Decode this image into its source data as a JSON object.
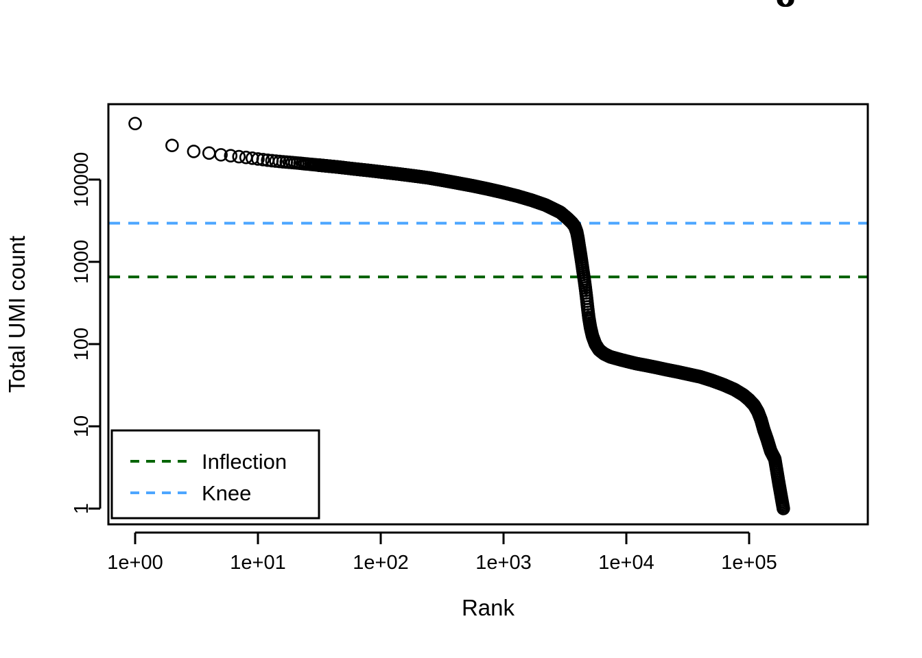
{
  "chart_data": {
    "type": "line",
    "title": "",
    "subtitle": "",
    "xlabel": "Rank",
    "ylabel": "Total UMI count",
    "xscale": "log",
    "yscale": "log",
    "grid": false,
    "xlim": [
      1,
      220000
    ],
    "ylim": [
      1,
      60000
    ],
    "xticks": [
      1,
      10,
      100,
      1000,
      10000,
      100000
    ],
    "xticklabels": [
      "1e+00",
      "1e+01",
      "1e+02",
      "1e+03",
      "1e+04",
      "1e+05"
    ],
    "yticks": [
      1,
      10,
      100,
      1000,
      10000
    ],
    "yticklabels": [
      "1",
      "10",
      "100",
      "1000",
      "10000"
    ],
    "marker": "open-circle",
    "legend_position": "bottom-left",
    "series": [
      {
        "name": "barcode-rank-curve",
        "type": "scatter",
        "marker": "open-circle",
        "color": "#000000",
        "x": [
          1,
          2,
          3,
          4,
          5,
          6,
          7,
          8,
          9,
          10,
          12,
          15,
          20,
          26,
          34,
          45,
          60,
          80,
          105,
          140,
          185,
          245,
          320,
          420,
          560,
          740,
          980,
          1300,
          1700,
          2200,
          2900,
          3300,
          3600,
          3800,
          3950,
          4050,
          4150,
          4250,
          4350,
          4450,
          4550,
          4650,
          4750,
          4850,
          4950,
          5100,
          5300,
          5600,
          6000,
          6600,
          7400,
          8500,
          10000,
          12000,
          14500,
          17500,
          21000,
          26000,
          32000,
          40000,
          50000,
          62000,
          76000,
          90000,
          100000,
          110000,
          118000,
          125000,
          132000,
          140000,
          150000,
          162000,
          175000,
          190000,
          205000
        ],
        "y": [
          48000,
          26000,
          22000,
          21000,
          20000,
          19500,
          19000,
          18600,
          18200,
          17800,
          17200,
          16600,
          16000,
          15400,
          14800,
          14200,
          13500,
          12900,
          12300,
          11700,
          11100,
          10500,
          9800,
          9100,
          8400,
          7700,
          7000,
          6300,
          5600,
          4900,
          4000,
          3400,
          3000,
          2700,
          2300,
          1900,
          1500,
          1200,
          950,
          750,
          600,
          470,
          360,
          270,
          210,
          160,
          125,
          100,
          85,
          76,
          70,
          66,
          62,
          58,
          55,
          52,
          49,
          46,
          43,
          40,
          36,
          32,
          28,
          24,
          21,
          18,
          15,
          12,
          9,
          7,
          5,
          4,
          2,
          1
        ]
      }
    ],
    "reference_lines": [
      {
        "name": "inflection",
        "label": "Inflection",
        "orientation": "horizontal",
        "value": 655,
        "color": "#006400",
        "style": "dashed"
      },
      {
        "name": "knee",
        "label": "Knee",
        "orientation": "horizontal",
        "value": 2950,
        "color": "#4DA6FF",
        "style": "dashed"
      }
    ],
    "legend": [
      {
        "label": "Inflection",
        "color": "#006400",
        "style": "dashed"
      },
      {
        "label": "Knee",
        "color": "#4DA6FF",
        "style": "dashed"
      }
    ]
  },
  "axes": {
    "x_title": "Rank",
    "y_title": "Total UMI count",
    "x_tick_labels": [
      "1e+00",
      "1e+01",
      "1e+02",
      "1e+03",
      "1e+04",
      "1e+05"
    ],
    "y_tick_labels": [
      "1",
      "10",
      "100",
      "1000",
      "10000"
    ]
  },
  "legend": {
    "inflection_label": "Inflection",
    "knee_label": "Knee"
  },
  "colors": {
    "inflection": "#006400",
    "knee": "#4DA6FF",
    "points": "#000000",
    "axis": "#000000",
    "background": "#ffffff"
  }
}
